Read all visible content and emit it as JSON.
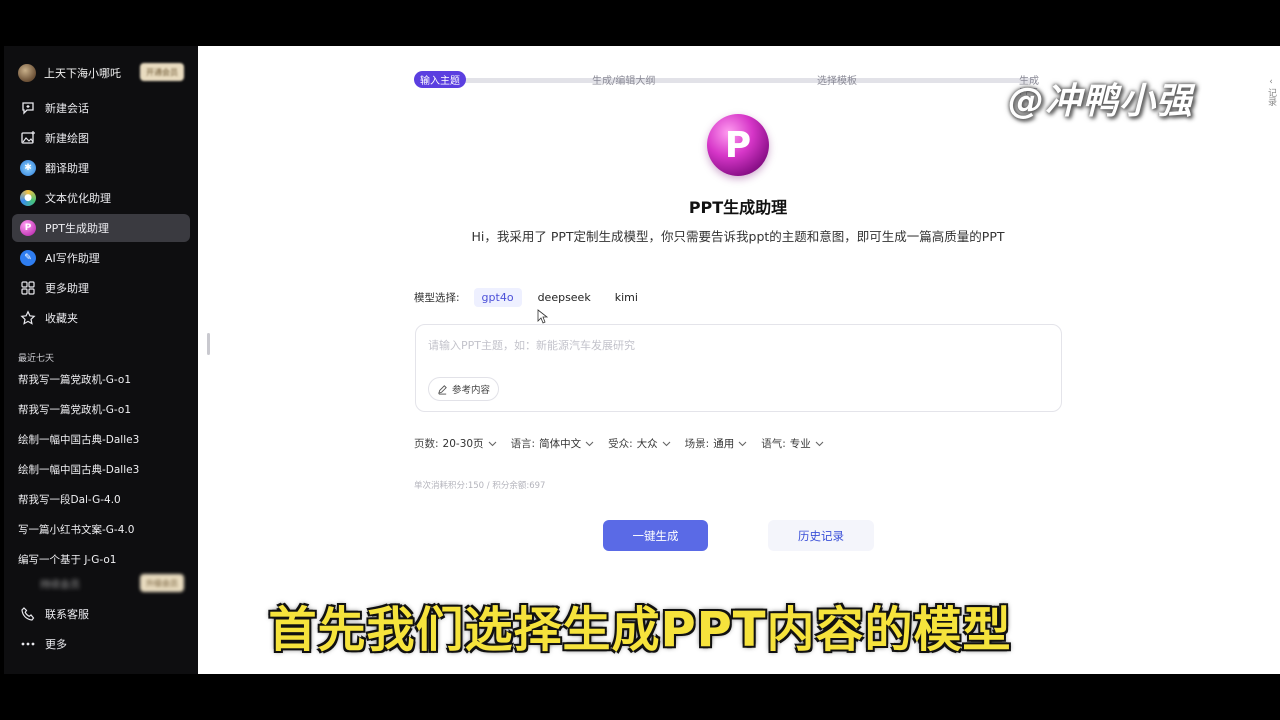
{
  "user": {
    "name": "上天下海小哪吒",
    "badge": "开通会员"
  },
  "nav": {
    "items": [
      {
        "label": "新建会话",
        "icon": "chat-plus-icon"
      },
      {
        "label": "新建绘图",
        "icon": "image-plus-icon"
      },
      {
        "label": "翻译助理",
        "icon": "translate-icon"
      },
      {
        "label": "文本优化助理",
        "icon": "text-optimize-icon"
      },
      {
        "label": "PPT生成助理",
        "icon": "ppt-icon",
        "active": true
      },
      {
        "label": "AI写作助理",
        "icon": "ai-write-icon"
      },
      {
        "label": "更多助理",
        "icon": "grid-icon"
      },
      {
        "label": "收藏夹",
        "icon": "star-icon"
      }
    ]
  },
  "recent": {
    "title": "最近七天",
    "items": [
      "帮我写一篇党政机-G-o1",
      "帮我写一篇党政机-G-o1",
      "绘制一幅中国古典-Dalle3",
      "绘制一幅中国古典-Dalle3",
      "帮我写一段Dal-G-4.0",
      "写一篇小红书文案-G-4.0",
      "编写一个基于 J-G-o1"
    ]
  },
  "blurred": {
    "text": "持续会员",
    "badge": "升级会员"
  },
  "bottom": {
    "items": [
      {
        "label": "联系客服",
        "icon": "phone-icon"
      },
      {
        "label": "更多",
        "icon": "more-icon"
      }
    ]
  },
  "steps": [
    "输入主题",
    "生成/编辑大纲",
    "选择模板",
    "生成PPT"
  ],
  "watermark": "@冲鸭小强",
  "side_tab": "记录",
  "logo_letter": "P",
  "title": "PPT生成助理",
  "description": "Hi，我采用了 PPT定制生成模型，你只需要告诉我ppt的主题和意图，即可生成一篇高质量的PPT",
  "model": {
    "label": "模型选择:",
    "options": [
      "gpt4o",
      "deepseek",
      "kimi"
    ],
    "selected": "gpt4o"
  },
  "input": {
    "placeholder": "请输入PPT主题，如：新能源汽车发展研究",
    "value": "",
    "ref_label": "参考内容"
  },
  "options": [
    {
      "key": "页数:",
      "value": "20-30页"
    },
    {
      "key": "语言:",
      "value": "简体中文"
    },
    {
      "key": "受众:",
      "value": "大众"
    },
    {
      "key": "场景:",
      "value": "通用"
    },
    {
      "key": "语气:",
      "value": "专业"
    }
  ],
  "credits": "单次消耗积分:150 / 积分余额:697",
  "buttons": {
    "generate": "一键生成",
    "history": "历史记录"
  },
  "caption": "首先我们选择生成PPT内容的模型",
  "colors": {
    "accent": "#5a6ae6",
    "step_active": "#5b3fe0",
    "caption": "#f6e33c"
  }
}
